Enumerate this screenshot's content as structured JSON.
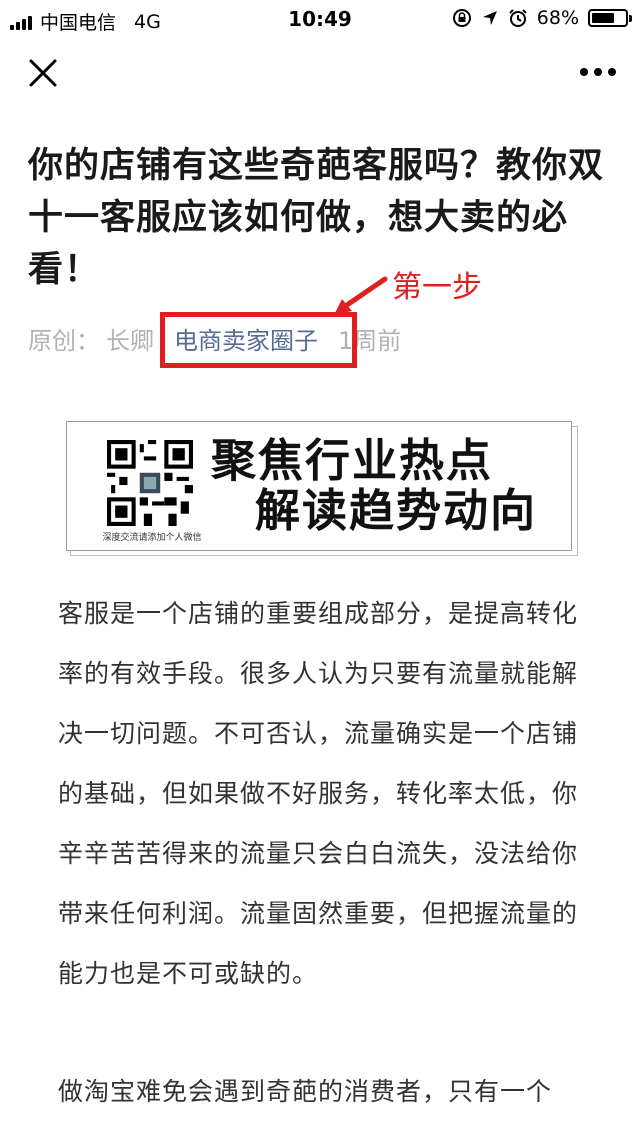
{
  "status_bar": {
    "carrier": "中国电信",
    "network": "4G",
    "time": "10:49",
    "battery": "68%",
    "battery_level": 0.68
  },
  "nav": {
    "close_icon": "close-icon",
    "more_icon": "more-dots-icon"
  },
  "article": {
    "title": "你的店铺有这些奇葩客服吗？教你双十一客服应该如何做，想大卖的必看！",
    "meta": {
      "original_label": "原创：",
      "author": "长卿",
      "account": "电商卖家圈子",
      "time": "1周前"
    },
    "annotation": "第一步",
    "banner": {
      "line1": "聚焦行业热点",
      "line2": "解读趋势动向",
      "qr_caption": "深度交流请添加个人微信"
    },
    "paragraphs": [
      "客服是一个店铺的重要组成部分，是提高转化率的有效手段。很多人认为只要有流量就能解决一切问题。不可否认，流量确实是一个店铺的基础，但如果做不好服务，转化率太低，你辛辛苦苦得来的流量只会白白流失，没法给你带来任何利润。流量固然重要，但把握流量的能力也是不可或缺的。",
      "做淘宝难免会遇到奇葩的消费者，只有一个"
    ]
  },
  "colors": {
    "annotation_red": "#e02020",
    "account_blue": "#576b95",
    "meta_gray": "#b2b2b2"
  }
}
